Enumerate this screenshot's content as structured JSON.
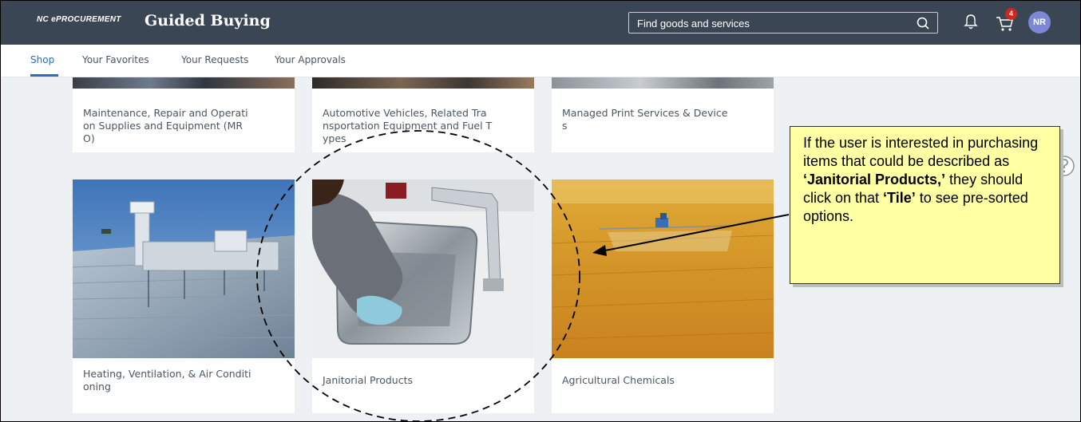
{
  "header": {
    "brand": "NC ePROCUREMENT",
    "title": "Guided Buying",
    "search": {
      "placeholder": "Find goods and services",
      "icon": "search-icon"
    },
    "cart_count": "4",
    "avatar_initials": "NR",
    "colors": {
      "bar": "#3b4654",
      "badge": "#d0271d",
      "avatar": "#7c88d6"
    }
  },
  "tabs": [
    {
      "label": "Shop",
      "active": true
    },
    {
      "label": "Your Favorites",
      "active": false
    },
    {
      "label": "Your Requests",
      "active": false
    },
    {
      "label": "Your Approvals",
      "active": false
    }
  ],
  "tiles_row1": [
    {
      "label": "Maintenance, Repair and Operati\non Supplies and Equipment (MR\nO)"
    },
    {
      "label": "Automotive Vehicles, Related Tra\nnsportation Equipment and Fuel T\nypes"
    },
    {
      "label": "Managed Print Services & Device\ns"
    }
  ],
  "tiles_row2": [
    {
      "label": "Heating, Ventilation, & Air Conditi\noning",
      "image": "hvac-rooftop-image"
    },
    {
      "label": "Janitorial Products",
      "image": "sink-cleaning-image"
    },
    {
      "label": "Agricultural Chemicals",
      "image": "crop-spraying-image"
    }
  ],
  "callout": {
    "t1": "If the user is interested in purchasing items that could be described as ",
    "b1": "‘Janitorial Products,’",
    "t2": " they should click on that ",
    "b2": "‘Tile’",
    "t3": " to see pre-sorted options.",
    "background": "#ffffa3"
  }
}
